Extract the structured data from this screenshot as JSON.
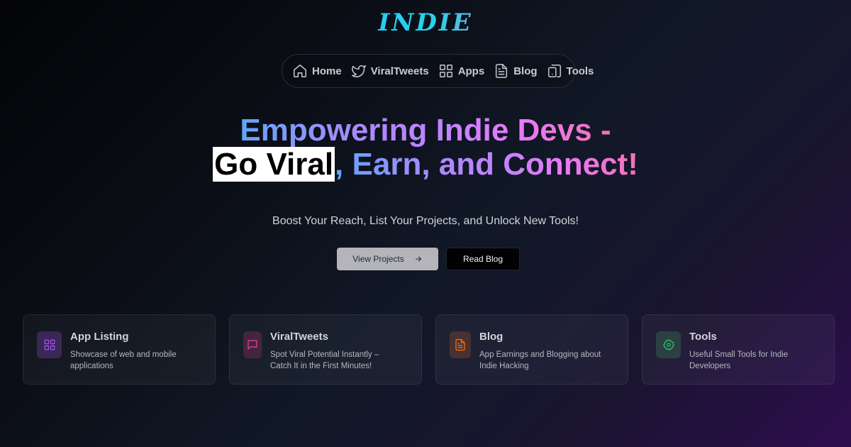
{
  "logo": {
    "text": "INDIE"
  },
  "nav": {
    "items": [
      {
        "label": "Home",
        "icon": "home-icon"
      },
      {
        "label": "ViralTweets",
        "icon": "twitter-icon"
      },
      {
        "label": "Apps",
        "icon": "grid-icon"
      },
      {
        "label": "Blog",
        "icon": "document-icon"
      },
      {
        "label": "Tools",
        "icon": "devices-icon"
      }
    ]
  },
  "hero": {
    "line1": "Empowering Indie Devs -",
    "highlight": "Go Viral",
    "line2_rest": ", Earn, and Connect!",
    "subtitle": "Boost Your Reach, List Your Projects, and Unlock New Tools!"
  },
  "buttons": {
    "primary": {
      "label": "View Projects",
      "icon": "arrow-right-icon"
    },
    "secondary": {
      "label": "Read Blog"
    }
  },
  "cards": [
    {
      "title": "App Listing",
      "description": "Showcase of web and mobile applications",
      "icon": "grid-icon",
      "accent": "#a855f7",
      "icon_bg": "#3b2757"
    },
    {
      "title": "ViralTweets",
      "description": "Spot Viral Potential Instantly – Catch It in the First Minutes!",
      "icon": "message-icon",
      "accent": "#ec4899",
      "icon_bg": "#43253f"
    },
    {
      "title": "Blog",
      "description": "App Earnings and Blogging about Indie Hacking",
      "icon": "document-icon",
      "accent": "#f97316",
      "icon_bg": "#4a3030"
    },
    {
      "title": "Tools",
      "description": "Useful Small Tools for Indie Developers",
      "icon": "gear-icon",
      "accent": "#22c55e",
      "icon_bg": "#2c3f42"
    }
  ]
}
